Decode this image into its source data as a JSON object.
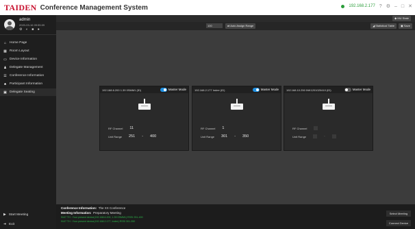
{
  "app": {
    "brand": "TAIDEN",
    "title": "Conference Management System",
    "ip": "192.168.2.177",
    "mu_state": "MU State"
  },
  "user": {
    "name": "admin",
    "date": "2020-03-16 09:55:09",
    "icons": "⚙ ◐ ■ ●"
  },
  "sidebar": {
    "items": [
      {
        "icon": "⌂",
        "label": "Home Page"
      },
      {
        "icon": "▦",
        "label": "Room Layout"
      },
      {
        "icon": "▭",
        "label": "Device Information"
      },
      {
        "icon": "♟",
        "label": "Delegate Management"
      },
      {
        "icon": "☰",
        "label": "Conference Information"
      },
      {
        "icon": "♣",
        "label": "Participant Information"
      },
      {
        "icon": "▣",
        "label": "Delegate Seating"
      }
    ],
    "start_meeting": "Start Meeting",
    "exit": "Exit"
  },
  "toolbar": {
    "channel_value": "100",
    "auto_assign": "Auto Assign Range",
    "statistical_table": "Statistical Table",
    "save": "Save"
  },
  "units": [
    {
      "header": "192.168.6.200 1.39 0SMM1 (ID)",
      "master_mode": "Master Mode",
      "toggle": "on",
      "rf_label": "RF Channel",
      "rf_value": "11",
      "range_label": "Unit Range",
      "range_from": "251",
      "range_sep": "-",
      "range_to": "400"
    },
    {
      "header": "192.168.2.177 Indee (ID)",
      "master_mode": "Master Mode",
      "toggle": "on",
      "rf_label": "RF Channel",
      "rf_value": "1",
      "range_label": "Unit Range",
      "range_from": "301",
      "range_sep": "-",
      "range_to": "350"
    },
    {
      "header": "192.168.10.250 INK1201020410 (ID)",
      "master_mode": "Master Mode",
      "toggle": "off",
      "rf_label": "RF Channel",
      "rf_value": "",
      "range_label": "Unit Range",
      "range_from": "",
      "range_sep": "-",
      "range_to": ""
    }
  ],
  "status": {
    "conf_label": "Conference Information:",
    "conf_value": "The XX Conference",
    "meeting_label": "Meeting Information:",
    "meeting_value": "Preparatory Meeting",
    "log1": "9/4/7 TH : Your present device(192.168.6.200, 1.39 0SMM1) RSSI 251-400",
    "log2": "9/4/7 TH : Your present device(192.168.2.177, Indee) RSSI 301-350",
    "select_meeting": "Select Meeting",
    "connect_device": "Connect Device"
  },
  "colors": {
    "brand_red": "#c8102e",
    "toggle_on": "#1f8fe0",
    "log_green": "#2db84a"
  }
}
